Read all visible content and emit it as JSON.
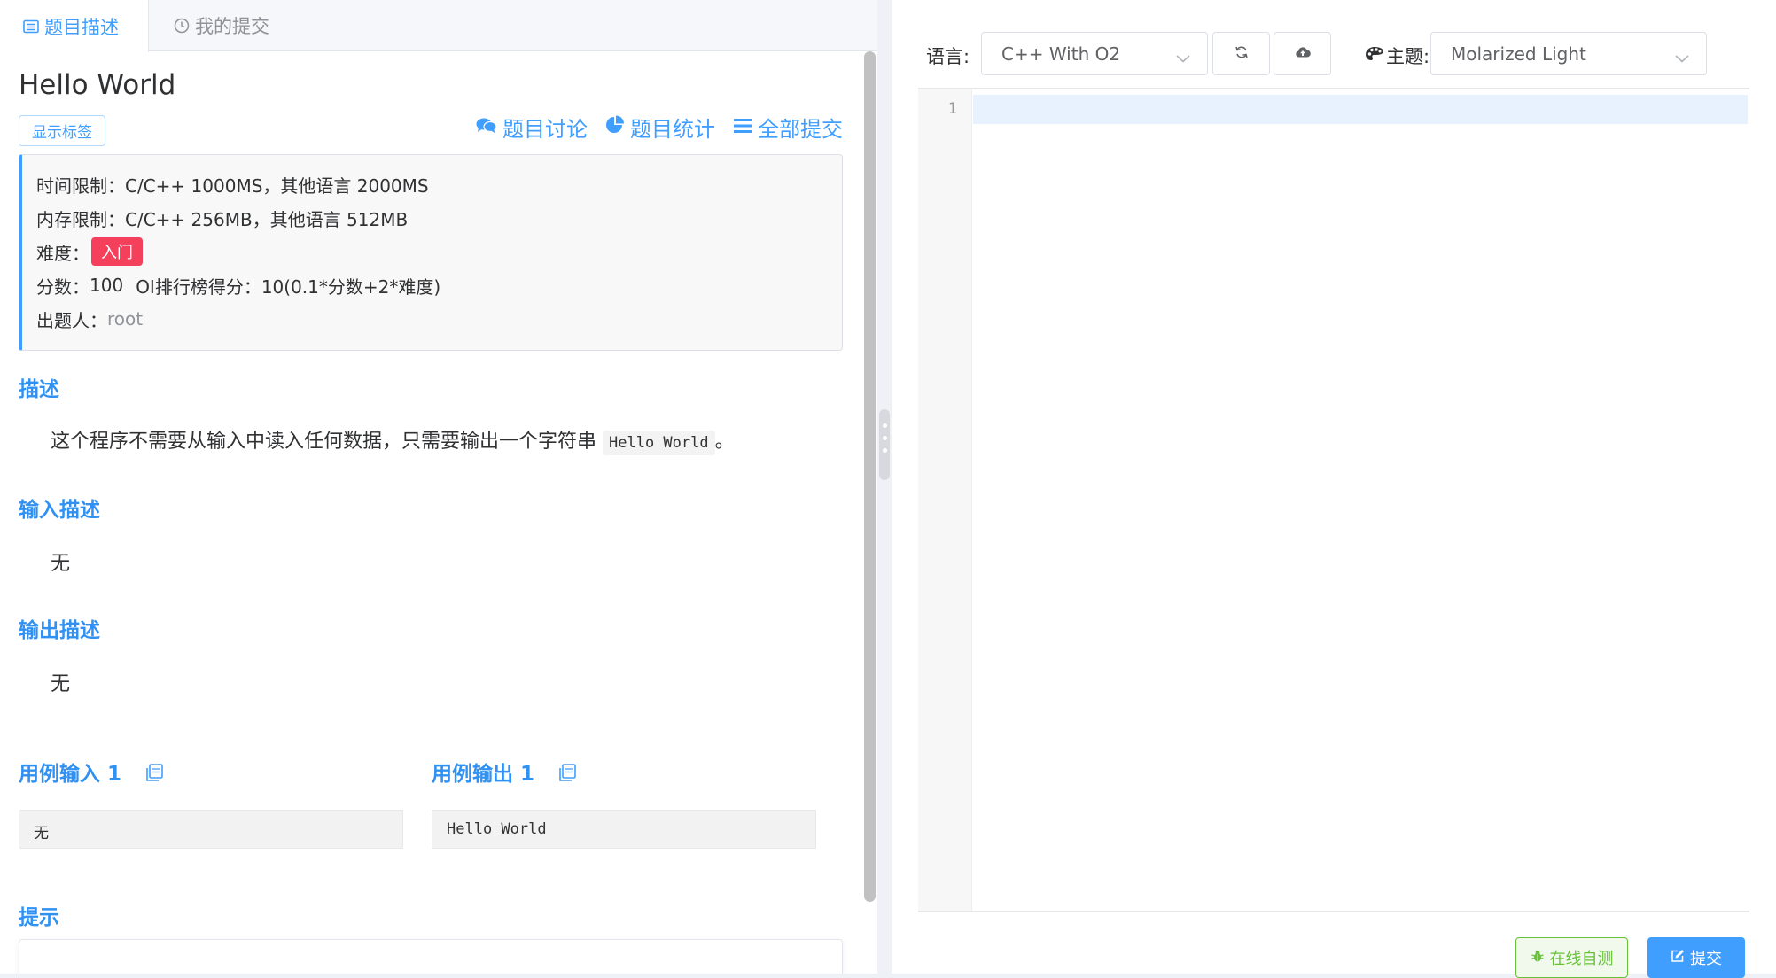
{
  "tabs": [
    {
      "label": "题目描述",
      "icon": "list-alt-icon",
      "active": true
    },
    {
      "label": "我的提交",
      "icon": "clock-icon",
      "active": false
    }
  ],
  "problem": {
    "title": "Hello World",
    "show_tags_label": "显示标签",
    "links": {
      "discussion": "题目讨论",
      "statistics": "题目统计",
      "all_submissions": "全部提交"
    },
    "info": {
      "time_limit_label": "时间限制：",
      "time_limit_value": "C/C++ 1000MS，其他语言 2000MS",
      "memory_limit_label": "内存限制：",
      "memory_limit_value": "C/C++ 256MB，其他语言 512MB",
      "difficulty_label": "难度：",
      "difficulty_value": "入门",
      "score_label": "分数：",
      "score_value": "100",
      "oi_rank_label": "OI排行榜得分：",
      "oi_rank_value": "10(0.1*分数+2*难度)",
      "author_label": "出题人：",
      "author_value": "root"
    },
    "description_heading": "描述",
    "description_text": "这个程序不需要从输入中读入任何数据，只需要输出一个字符串",
    "description_code": "Hello World",
    "description_end": "。",
    "input_heading": "输入描述",
    "input_text": "无",
    "output_heading": "输出描述",
    "output_text": "无",
    "sample_input_heading": "用例输入 1",
    "sample_input_value": "无",
    "sample_output_heading": "用例输出 1",
    "sample_output_value": "Hello World",
    "hint_heading": "提示"
  },
  "editor": {
    "language_label": "语言:",
    "language_value": "C++ With O2",
    "theme_label": "主题:",
    "theme_value": "Molarized Light",
    "line_numbers": [
      "1"
    ],
    "test_button": "在线自测",
    "submit_button": "提交"
  },
  "colors": {
    "accent": "#409eff",
    "heading": "#3091f2",
    "difficulty_badge": "#f4405a",
    "test_button": "#67c23a"
  }
}
